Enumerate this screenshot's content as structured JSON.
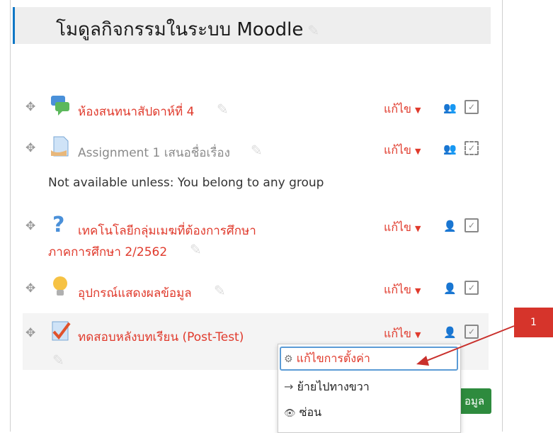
{
  "section": {
    "title": "โมดูลกิจกรรมในระบบ Moodle"
  },
  "edit_label": "แก้ไข",
  "activities": [
    {
      "name": "ห้องสนทนาสัปดาห์ที่ 4",
      "icon": "chat-icon",
      "group_icon": "group-icon"
    },
    {
      "name": "Assignment 1 เสนอชื่อเรื่อง",
      "icon": "assignment-icon",
      "group_icon": "group-icon"
    },
    {
      "name_line1": "เทคโนโลยีกลุ่มเมฆที่ต้องการศึกษา",
      "name_line2": "ภาคการศึกษา 2/2562",
      "icon": "question-icon",
      "group_icon": "user-icon"
    },
    {
      "name": "อุปกรณ์แสดงผลข้อมูล",
      "icon": "lightbulb-icon",
      "group_icon": "user-icon"
    },
    {
      "name": "ทดสอบหลังบทเรียน (Post-Test)",
      "icon": "quiz-icon",
      "group_icon": "user-icon"
    }
  ],
  "restriction_text": "Not available unless: You belong to any group",
  "dropdown": [
    {
      "label": "แก้ไขการตั้งค่า",
      "icon": "gear-icon"
    },
    {
      "label": "ย้ายไปทางขวา",
      "icon": "arrow-right-icon"
    },
    {
      "label": "ซ่อน",
      "icon": "eye-icon"
    }
  ],
  "green_button_label": "อมูล",
  "callout": {
    "number": "1"
  }
}
